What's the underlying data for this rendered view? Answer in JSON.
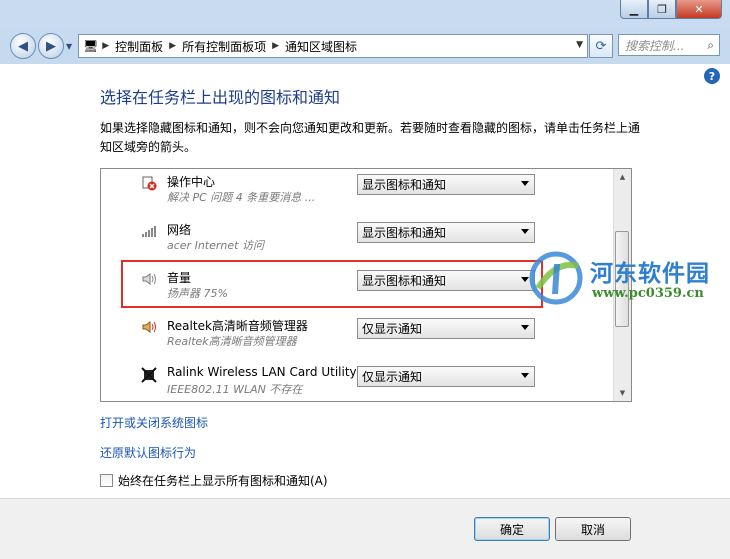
{
  "window": {
    "controls": {
      "minimize": "▁",
      "maximize": "❐",
      "close": "✕"
    }
  },
  "nav": {
    "breadcrumbs": [
      "控制面板",
      "所有控制面板项",
      "通知区域图标"
    ],
    "search_placeholder": "搜索控制..."
  },
  "page": {
    "heading": "选择在任务栏上出现的图标和通知",
    "description": "如果选择隐藏图标和通知，则不会向您通知更改和更新。若要随时查看隐藏的图标，请单击任务栏上通知区域旁的箭头。",
    "items": [
      {
        "name": "操作中心",
        "sub": "解决 PC 问题  4 条重要消息  ...",
        "behavior": "显示图标和通知",
        "icon": "action-center-icon"
      },
      {
        "name": "网络",
        "sub": "acer Internet 访问",
        "behavior": "显示图标和通知",
        "icon": "network-icon"
      },
      {
        "name": "音量",
        "sub": "扬声器 75%",
        "behavior": "显示图标和通知",
        "icon": "speaker-icon"
      },
      {
        "name": "Realtek高清晰音频管理器",
        "sub": "Realtek高清晰音频管理器",
        "behavior": "仅显示通知",
        "icon": "realtek-speaker-icon"
      },
      {
        "name": "Ralink Wireless LAN Card Utility",
        "sub": "IEEE802.11 WLAN 不存在",
        "behavior": "仅显示通知",
        "icon": "wireless-disabled-icon"
      }
    ],
    "links": {
      "system_icons": "打开或关闭系统图标",
      "restore": "还原默认图标行为"
    },
    "always_show_label": "始终在任务栏上显示所有图标和通知(A)"
  },
  "footer": {
    "ok": "确定",
    "cancel": "取消"
  },
  "watermark": {
    "title": "河东软件园",
    "url": "www.pc0359.cn"
  },
  "colors": {
    "heading": "#1e3d8a",
    "link": "#1b55b7",
    "highlight": "#e0302c"
  }
}
